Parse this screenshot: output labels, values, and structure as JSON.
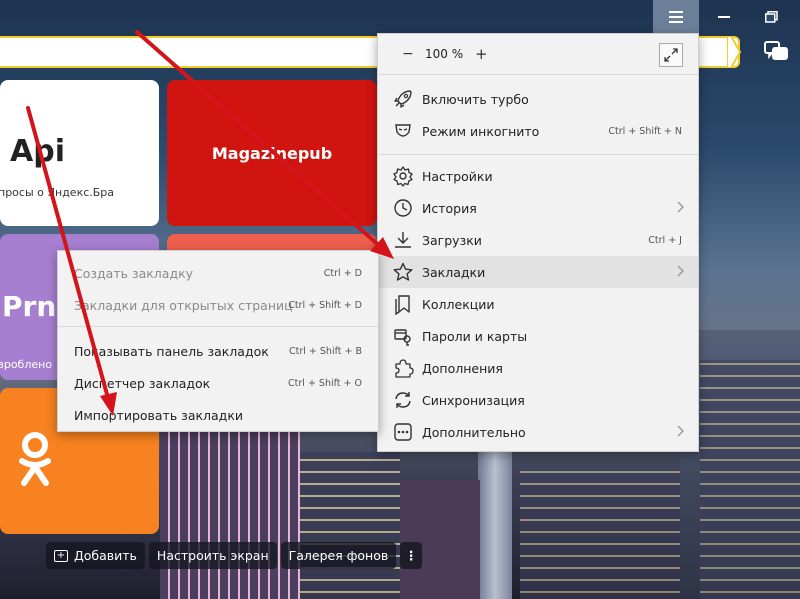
{
  "colors": {
    "address_border": "#f3cb2b",
    "menu_bg": "#f2f2f2",
    "highlight": "#e2e2e2",
    "arrow": "#d4141b",
    "tile_magazine": "#d0140f",
    "tile_prnt": "#a77fd1",
    "tile_ok": "#f7821f"
  },
  "window": {
    "menu_icon": "hamburger-icon",
    "minimize_icon": "minimize-icon",
    "restore_icon": "restore-icon"
  },
  "tiles": {
    "api": {
      "title": "Api",
      "caption": "просы о Яндекс.Бра"
    },
    "magazine": {
      "title": "Magazinepub"
    },
    "prnt": {
      "title": "Prn",
      "caption": "зроблено"
    }
  },
  "bottom_bar": {
    "add": "Добавить",
    "customize": "Настроить экран",
    "gallery": "Галерея фонов",
    "more": "⋮"
  },
  "main_menu": {
    "zoom": {
      "minus": "−",
      "value": "100 %",
      "plus": "+"
    },
    "items": [
      {
        "label": "Включить турбо",
        "icon": "rocket-icon"
      },
      {
        "label": "Режим инкогнито",
        "shortcut": "Ctrl + Shift + N",
        "icon": "incognito-mask-icon"
      },
      {
        "label": "Настройки",
        "icon": "gear-icon"
      },
      {
        "label": "История",
        "icon": "clock-icon"
      },
      {
        "label": "Загрузки",
        "shortcut": "Ctrl + J",
        "icon": "download-icon"
      },
      {
        "label": "Закладки",
        "icon": "star-icon"
      },
      {
        "label": "Коллекции",
        "icon": "collections-icon"
      },
      {
        "label": "Пароли и карты",
        "icon": "key-card-icon"
      },
      {
        "label": "Дополнения",
        "icon": "puzzle-icon"
      },
      {
        "label": "Синхронизация",
        "icon": "sync-icon"
      },
      {
        "label": "Дополнительно",
        "icon": "more-dots-icon"
      }
    ]
  },
  "bookmarks_submenu": {
    "items": [
      {
        "label": "Создать закладку",
        "shortcut": "Ctrl + D"
      },
      {
        "label": "Закладки для открытых страниц",
        "shortcut": "Ctrl + Shift + D"
      },
      {
        "label": "Показывать панель закладок",
        "shortcut": "Ctrl + Shift + B"
      },
      {
        "label": "Диспетчер закладок",
        "shortcut": "Ctrl + Shift + O"
      },
      {
        "label": "Импортировать закладки"
      }
    ]
  }
}
